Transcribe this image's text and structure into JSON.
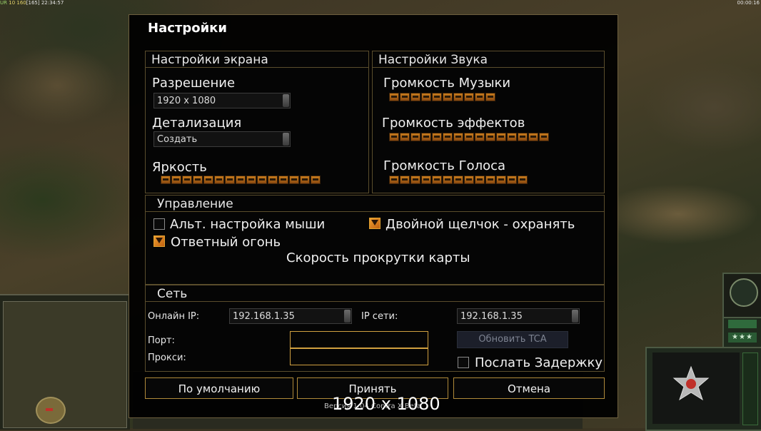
{
  "hud": {
    "top_left_a": "UR",
    "top_left_b": "10",
    "top_left_c": "160",
    "top_left_d": "[165]",
    "top_left_time": "22:34:57",
    "top_right_time": "00:00:16"
  },
  "dialog": {
    "title": "Настройки",
    "screen": {
      "header": "Настройки экрана",
      "resolution_label": "Разрешение",
      "resolution_value": "1920 x 1080",
      "detail_label": "Детализация",
      "detail_value": "Создать",
      "brightness_label": "Яркость",
      "brightness_segments": 15
    },
    "sound": {
      "header": "Настройки Звука",
      "music_label": "Громкость Музыки",
      "music_segments": 10,
      "effects_label": "Громкость эффектов",
      "effects_segments": 15,
      "voice_label": "Громкость Голоса",
      "voice_segments": 13
    },
    "control": {
      "header": "Управление",
      "alt_mouse_label": "Альт. настройка мыши",
      "alt_mouse_checked": false,
      "double_click_label": "Двойной щелчок - охранять",
      "double_click_checked": true,
      "return_fire_label": "Ответный огонь",
      "return_fire_checked": true,
      "scroll_speed_label": "Скорость прокрутки карты"
    },
    "network": {
      "header": "Сеть",
      "online_ip_label": "Онлайн IP:",
      "online_ip_value": "192.168.1.35",
      "lan_ip_label": "IP сети:",
      "lan_ip_value": "192.168.1.35",
      "port_label": "Порт:",
      "port_value": "",
      "proxy_label": "Прокси:",
      "proxy_value": "",
      "update_button": "Обновить TCA",
      "send_delay_label": "Послать Задержку",
      "send_delay_checked": false
    },
    "buttons": {
      "default": "По умолчанию",
      "accept": "Принять",
      "cancel": "Отмена"
    }
  },
  "overlay": {
    "resolution_text": "1920 x 1080",
    "version_text": "Версия 1.04 Contra X Beta"
  },
  "colors": {
    "accent": "#c87c1d",
    "border": "#5a4d2c",
    "button_border": "#b08a3a"
  }
}
